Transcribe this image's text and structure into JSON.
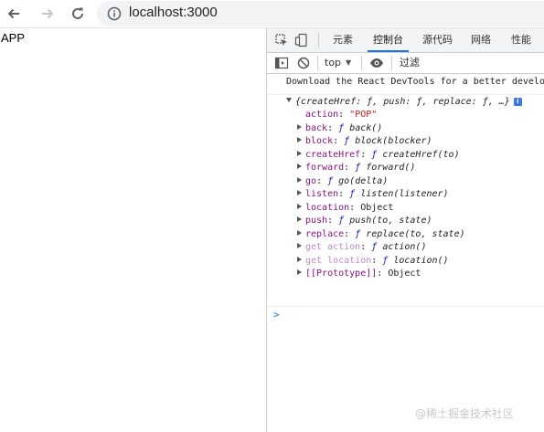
{
  "browser": {
    "url": "localhost:3000",
    "icons": [
      "back-arrow-icon",
      "forward-arrow-icon",
      "reload-icon",
      "info-icon"
    ]
  },
  "page": {
    "text": "APP"
  },
  "devtools": {
    "tabs": [
      "元素",
      "控制台",
      "源代码",
      "网络",
      "性能"
    ],
    "active_tab": "控制台",
    "toolbar": {
      "context": "top",
      "filter_placeholder": "过滤"
    },
    "console": {
      "message": "Download the React DevTools for a better develop",
      "object_preview": "{createHref: ƒ, push: ƒ, replace: ƒ, …}",
      "info_badge": "i",
      "props": [
        {
          "key": "action",
          "sep": ": ",
          "value": "\"POP\"",
          "kind": "string",
          "expandable": false,
          "dim": false
        },
        {
          "key": "back",
          "sep": ": ",
          "value": "back()",
          "kind": "function",
          "expandable": true,
          "dim": false
        },
        {
          "key": "block",
          "sep": ": ",
          "value": "block(blocker)",
          "kind": "function",
          "expandable": true,
          "dim": false
        },
        {
          "key": "createHref",
          "sep": ": ",
          "value": "createHref(to)",
          "kind": "function",
          "expandable": true,
          "dim": false
        },
        {
          "key": "forward",
          "sep": ": ",
          "value": "forward()",
          "kind": "function",
          "expandable": true,
          "dim": false
        },
        {
          "key": "go",
          "sep": ": ",
          "value": "go(delta)",
          "kind": "function",
          "expandable": true,
          "dim": false
        },
        {
          "key": "listen",
          "sep": ": ",
          "value": "listen(listener)",
          "kind": "function",
          "expandable": true,
          "dim": false
        },
        {
          "key": "location",
          "sep": ": ",
          "value": "Object",
          "kind": "object",
          "expandable": true,
          "dim": false
        },
        {
          "key": "push",
          "sep": ": ",
          "value": "push(to, state)",
          "kind": "function",
          "expandable": true,
          "dim": false
        },
        {
          "key": "replace",
          "sep": ": ",
          "value": "replace(to, state)",
          "kind": "function",
          "expandable": true,
          "dim": false
        },
        {
          "key": "get action",
          "sep": ": ",
          "value": "action()",
          "kind": "function",
          "expandable": true,
          "dim": true
        },
        {
          "key": "get location",
          "sep": ": ",
          "value": "location()",
          "kind": "function",
          "expandable": true,
          "dim": true
        },
        {
          "key": "[[Prototype]]",
          "sep": ": ",
          "value": "Object",
          "kind": "object",
          "expandable": true,
          "dim": false
        }
      ],
      "prompt": ">"
    }
  },
  "watermark": "@稀土掘金技术社区",
  "colors": {
    "accent": "#1a73e8",
    "key": "#881280",
    "string": "#c41a16",
    "badge": "#3b78e7"
  }
}
